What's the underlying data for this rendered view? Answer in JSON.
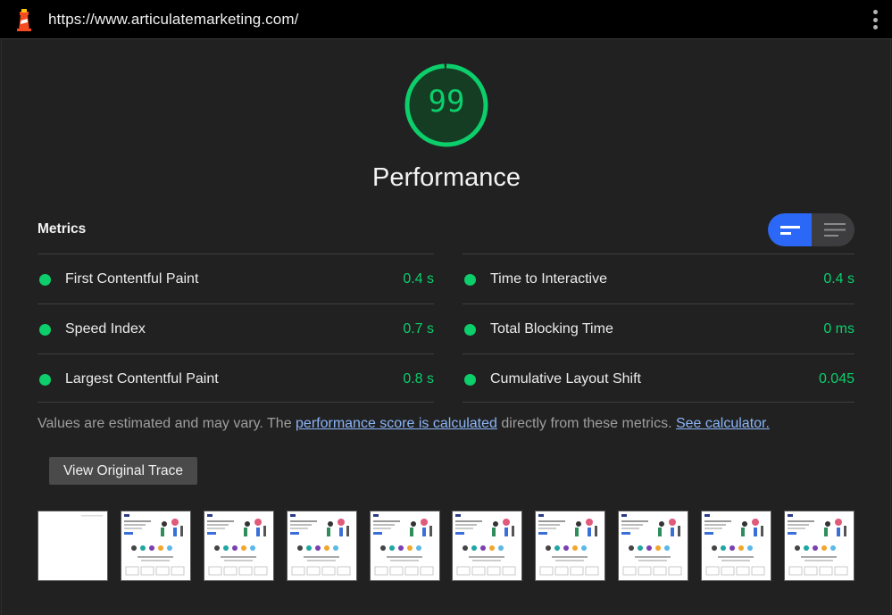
{
  "topbar": {
    "url": "https://www.articulatemarketing.com/",
    "logo_icon": "lighthouse-icon",
    "menu_icon": "kebab-menu-icon"
  },
  "score": {
    "value": "99",
    "fraction": 0.99,
    "title": "Performance",
    "color": "#0cce6b"
  },
  "metrics": {
    "heading": "Metrics",
    "view_toggle": {
      "selected": "compact",
      "options": [
        "compact-view-icon",
        "expanded-view-icon"
      ],
      "accent": "#2b68f7"
    },
    "left": [
      {
        "name": "First Contentful Paint",
        "value": "0.4 s"
      },
      {
        "name": "Speed Index",
        "value": "0.7 s"
      },
      {
        "name": "Largest Contentful Paint",
        "value": "0.8 s"
      }
    ],
    "right": [
      {
        "name": "Time to Interactive",
        "value": "0.4 s"
      },
      {
        "name": "Total Blocking Time",
        "value": "0 ms"
      },
      {
        "name": "Cumulative Layout Shift",
        "value": "0.045"
      }
    ],
    "pass_color": "#0cce6b"
  },
  "note": {
    "prefix": "Values are estimated and may vary. The ",
    "link1": "performance score is calculated",
    "middle": " directly from these metrics. ",
    "link2": "See calculator."
  },
  "trace_button": "View Original Trace",
  "filmstrip": {
    "frames": [
      "blank",
      "page",
      "page",
      "page",
      "page",
      "page",
      "page",
      "page",
      "page",
      "page"
    ]
  }
}
